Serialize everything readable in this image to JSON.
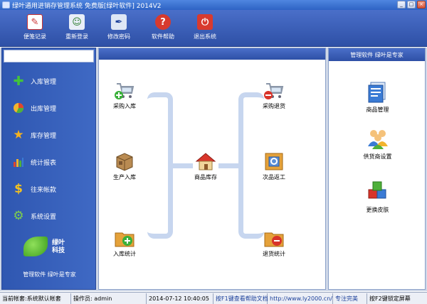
{
  "window": {
    "title": "绿叶通用进销存管理系统 免费版[绿叶软件] 2014V2",
    "controls": [
      "_",
      "□",
      "×"
    ]
  },
  "toolbar": {
    "items": [
      {
        "label": "便笺记录",
        "icon": "notepad-icon"
      },
      {
        "label": "重新登录",
        "icon": "users-icon"
      },
      {
        "label": "修改密码",
        "icon": "pen-icon"
      },
      {
        "label": "软件帮助",
        "icon": "help-icon"
      },
      {
        "label": "退出系统",
        "icon": "power-icon"
      }
    ]
  },
  "sidebar": {
    "items": [
      {
        "label": "入库管理",
        "icon": "plus-icon"
      },
      {
        "label": "出库管理",
        "icon": "pie-icon"
      },
      {
        "label": "库存管理",
        "icon": "star-icon"
      },
      {
        "label": "统计报表",
        "icon": "bar-chart-icon"
      },
      {
        "label": "往来帐款",
        "icon": "dollar-icon"
      },
      {
        "label": "系统设置",
        "icon": "gear-icon"
      }
    ],
    "logo_line1": "绿叶",
    "logo_line2": "科技",
    "slogan": "管理软件 绿叶是专家"
  },
  "center": {
    "left_nodes": [
      "采购入库",
      "生产入库",
      "入库统计"
    ],
    "middle_node": "商品库存",
    "right_nodes": [
      "采购退货",
      "次品返工",
      "退货统计"
    ]
  },
  "right_panel": {
    "header": "管理软件 绿叶是专家",
    "items": [
      "商品管理",
      "供货商设置",
      "更换皮肤"
    ]
  },
  "statusbar": {
    "account": "当前帐套:系统默认帐套",
    "operator": "操作员: admin",
    "datetime": "2014-07-12 10:40:05",
    "help": "按F1键查看帮助文档",
    "url": "http://www.ly2000.cn/",
    "slogan": "专注完美",
    "lock": "按F2键锁定屏幕"
  }
}
